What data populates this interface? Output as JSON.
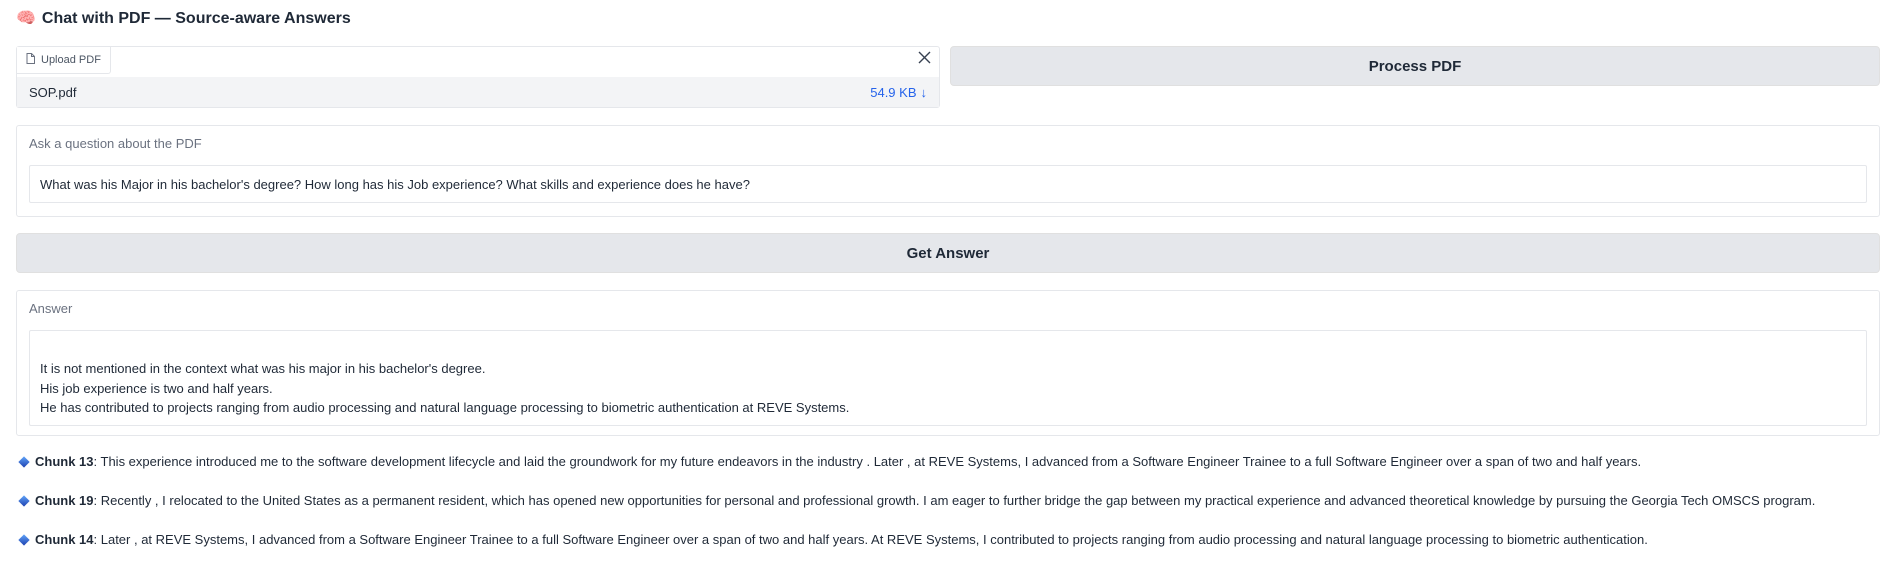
{
  "app": {
    "title_icon": "brain-icon",
    "title": "Chat with PDF — Source-aware Answers"
  },
  "upload": {
    "tab_label": "Upload PDF",
    "file_name": "SOP.pdf",
    "file_size": "54.9 KB",
    "download_glyph": "↓"
  },
  "process_button": "Process PDF",
  "question": {
    "label": "Ask a question about the PDF",
    "value": "What was his Major in his bachelor's degree? How long has his Job experience? What skills and experience does he have?"
  },
  "answer_button": "Get Answer",
  "answer": {
    "label": "Answer",
    "lines": [
      "It is not mentioned in the context what was his major in his bachelor's degree.",
      "His job experience is two and half years.",
      "He has contributed to projects ranging from audio processing and natural language processing to biometric authentication at REVE Systems."
    ]
  },
  "chunks": [
    {
      "label": "Chunk 13",
      "text": ": This experience introduced me to the software development lifecycle and laid the groundwork for my future endeavors in the industry . Later , at REVE Systems, I advanced from a Software Engineer Trainee to a full Software Engineer over a span of two and half years."
    },
    {
      "label": "Chunk 19",
      "text": ": Recently , I relocated to the United States as a permanent resident, which has opened new opportunities for personal and professional growth. I am eager to further bridge the gap between my practical experience and advanced theoretical knowledge by pursuing the Georgia Tech OMSCS program."
    },
    {
      "label": "Chunk 14",
      "text": ": Later , at REVE Systems, I advanced from a Software Engineer Trainee to a full Software Engineer over a span of two and half years. At REVE Systems, I contributed to projects ranging from audio processing and natural language processing to biometric authentication."
    }
  ],
  "colors": {
    "accent_link": "#2563eb",
    "button_bg": "#e5e7eb",
    "chunk_icon": "#1e40af"
  }
}
